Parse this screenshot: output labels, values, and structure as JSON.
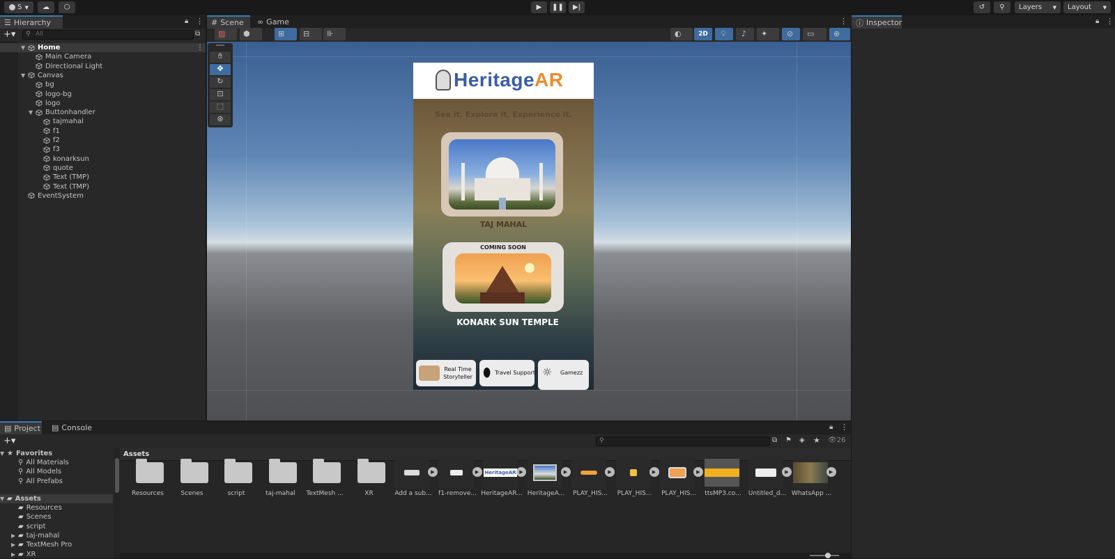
{
  "toolbar": {
    "account_label": "S",
    "layers_label": "Layers",
    "layout_label": "Layout"
  },
  "hierarchy": {
    "tab_label": "Hierarchy",
    "search_placeholder": "All",
    "items": [
      {
        "label": "Home",
        "bold": true
      },
      {
        "label": "Main Camera"
      },
      {
        "label": "Directional Light"
      },
      {
        "label": "Canvas"
      },
      {
        "label": "bg"
      },
      {
        "label": "logo-bg"
      },
      {
        "label": "logo"
      },
      {
        "label": "Buttonhandler"
      },
      {
        "label": "tajmahal"
      },
      {
        "label": "f1"
      },
      {
        "label": "f2"
      },
      {
        "label": "f3"
      },
      {
        "label": "konarksun"
      },
      {
        "label": "quote"
      },
      {
        "label": "Text (TMP)"
      },
      {
        "label": "Text (TMP)"
      },
      {
        "label": "EventSystem"
      }
    ]
  },
  "scene": {
    "tab_scene": "Scene",
    "tab_game": "Game",
    "mode_2d": "2D"
  },
  "app": {
    "title": "HeritageAR",
    "title_a": "Heritage",
    "title_b": "AR",
    "tagline": "See it. Explore it. Experience it.",
    "card1_label": "TAJ MAHAL",
    "coming_soon": "COMING SOON",
    "card2_label": "KONARK SUN TEMPLE",
    "btn1_line1": "Real Time",
    "btn1_line2": "Storyteller",
    "btn2": "Travel Support",
    "btn3": "Gamezz"
  },
  "inspector": {
    "tab_label": "Inspector"
  },
  "project": {
    "tab_project": "Project",
    "tab_console": "Console",
    "breadcrumb": "Assets",
    "visible_count": "26",
    "favorites_label": "Favorites",
    "favorites": [
      "All Materials",
      "All Models",
      "All Prefabs"
    ],
    "assets_label": "Assets",
    "tree": [
      {
        "label": "Resources"
      },
      {
        "label": "Scenes"
      },
      {
        "label": "script"
      },
      {
        "label": "taj-mahal"
      },
      {
        "label": "TextMesh Pro"
      },
      {
        "label": "XR"
      }
    ],
    "assets": [
      {
        "label": "Resources",
        "kind": "folder"
      },
      {
        "label": "Scenes",
        "kind": "folder"
      },
      {
        "label": "script",
        "kind": "folder"
      },
      {
        "label": "taj-mahal",
        "kind": "folder"
      },
      {
        "label": "TextMesh ...",
        "kind": "folder"
      },
      {
        "label": "XR",
        "kind": "folder"
      },
      {
        "label": "Add a sub...",
        "kind": "image"
      },
      {
        "label": "f1-remove...",
        "kind": "image"
      },
      {
        "label": "HeritageAR...",
        "kind": "image"
      },
      {
        "label": "HeritageA...",
        "kind": "image"
      },
      {
        "label": "PLAY_HIS...",
        "kind": "image"
      },
      {
        "label": "PLAY_HIS...",
        "kind": "image"
      },
      {
        "label": "PLAY_HIS...",
        "kind": "image"
      },
      {
        "label": "ttsMP3.co...",
        "kind": "audio"
      },
      {
        "label": "Untitled_d...",
        "kind": "image"
      },
      {
        "label": "WhatsApp ...",
        "kind": "image"
      }
    ]
  }
}
